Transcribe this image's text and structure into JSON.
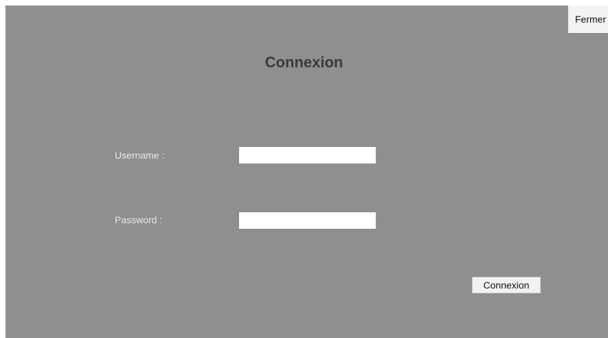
{
  "window": {
    "close_label": "Fermer",
    "title": "Connexion"
  },
  "form": {
    "username_label": "Username :",
    "username_value": "",
    "password_label": "Password :",
    "password_value": "",
    "submit_label": "Connexion"
  },
  "colors": {
    "background": "#8f8f8f",
    "title": "#3a3a3a",
    "label": "#e8e8e8",
    "field": "#ffffff",
    "button": "#f2f2f2"
  }
}
